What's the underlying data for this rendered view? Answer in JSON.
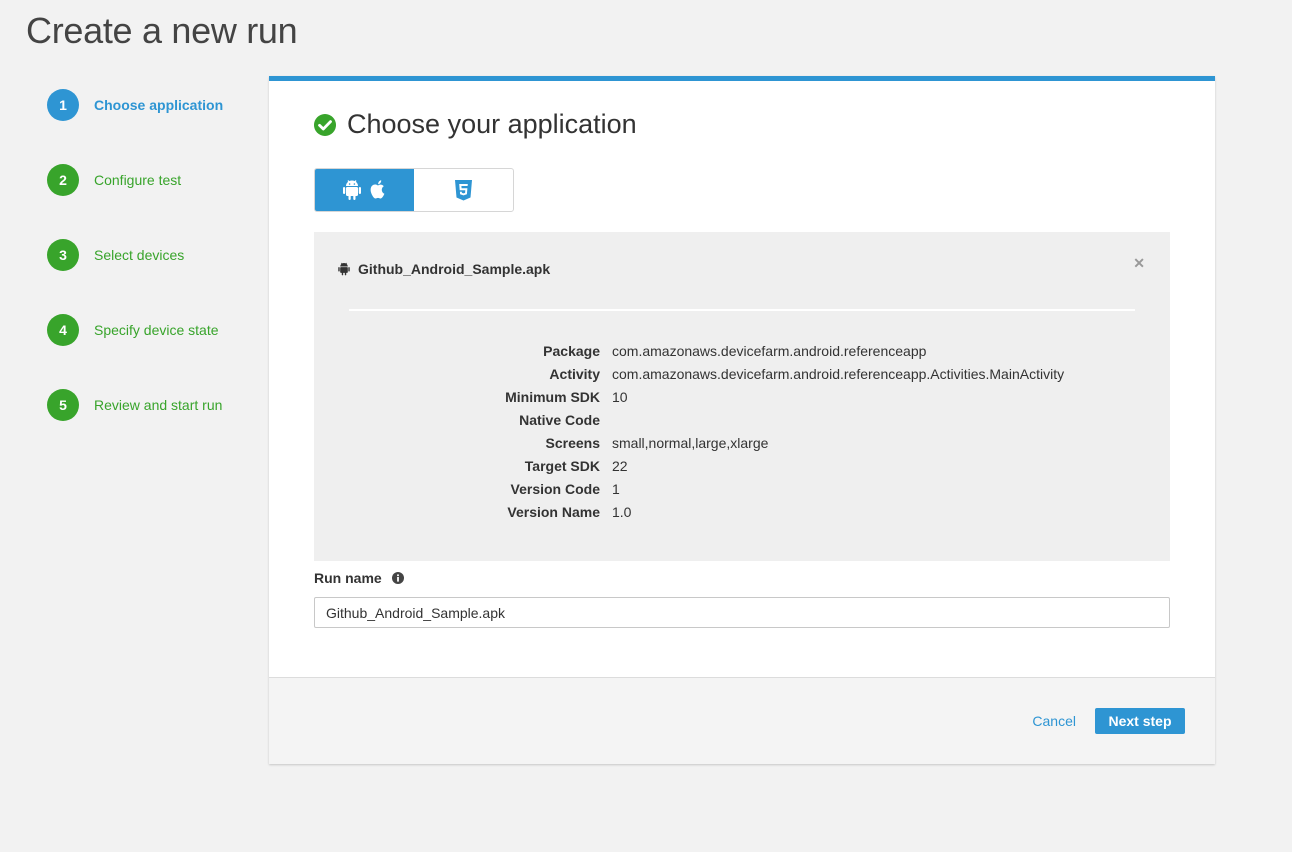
{
  "page": {
    "title": "Create a new run"
  },
  "steps": [
    {
      "number": "1",
      "label": "Choose application",
      "state": "active"
    },
    {
      "number": "2",
      "label": "Configure test",
      "state": "pending"
    },
    {
      "number": "3",
      "label": "Select devices",
      "state": "pending"
    },
    {
      "number": "4",
      "label": "Specify device state",
      "state": "pending"
    },
    {
      "number": "5",
      "label": "Review and start run",
      "state": "pending"
    }
  ],
  "section": {
    "title": "Choose your application",
    "icon": "check-circle-icon"
  },
  "app_type_toggle": {
    "options": [
      {
        "icons": [
          "android-icon",
          "apple-icon"
        ],
        "selected": true
      },
      {
        "icons": [
          "html5-icon"
        ],
        "selected": false
      }
    ]
  },
  "app": {
    "file_name": "Github_Android_Sample.apk",
    "properties": [
      {
        "label": "Package",
        "value": "com.amazonaws.devicefarm.android.referenceapp"
      },
      {
        "label": "Activity",
        "value": "com.amazonaws.devicefarm.android.referenceapp.Activities.MainActivity"
      },
      {
        "label": "Minimum SDK",
        "value": "10"
      },
      {
        "label": "Native Code",
        "value": ""
      },
      {
        "label": "Screens",
        "value": "small,normal,large,xlarge"
      },
      {
        "label": "Target SDK",
        "value": "22"
      },
      {
        "label": "Version Code",
        "value": "1"
      },
      {
        "label": "Version Name",
        "value": "1.0"
      }
    ]
  },
  "run_name": {
    "label": "Run name",
    "value": "Github_Android_Sample.apk"
  },
  "footer": {
    "cancel_label": "Cancel",
    "next_label": "Next step"
  },
  "colors": {
    "accent": "#2e95d3",
    "complete": "#38a42b",
    "topbar": "#2e95d3"
  }
}
